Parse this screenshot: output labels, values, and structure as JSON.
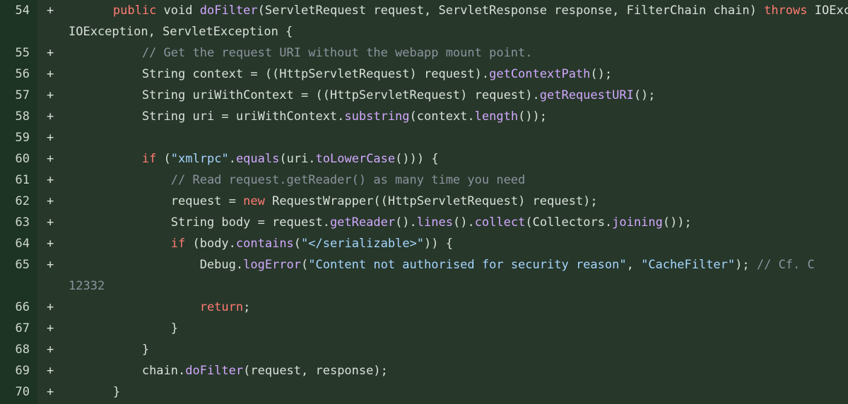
{
  "view": {
    "kind": "code-diff",
    "language": "Java",
    "change_type": "addition",
    "marker": "+"
  },
  "colors": {
    "gutter_background": "#1d3323",
    "code_background": "#27372a",
    "line_number": "#cfd8d0",
    "plain_text": "#d8e0da",
    "keyword": "#ff7b72",
    "function": "#d2a8ff",
    "string": "#a5d6ff",
    "comment": "#8b949e"
  },
  "lines": [
    {
      "number": "54",
      "marker": "+",
      "clipped": true,
      "tokens": [
        {
          "t": "        ",
          "c": "pln"
        },
        {
          "t": "public",
          "c": "kw"
        },
        {
          "t": " void ",
          "c": "pln"
        },
        {
          "t": "doFilter",
          "c": "fn"
        },
        {
          "t": "(ServletRequest request, ServletResponse response, FilterChain chain) ",
          "c": "pln"
        },
        {
          "t": "throws",
          "c": "kw"
        },
        {
          "t": " IOException, ServletException {",
          "c": "pln"
        }
      ],
      "continuation": [
        {
          "t": "IOException, ServletException {",
          "c": "pln"
        }
      ]
    },
    {
      "number": "55",
      "marker": "+",
      "clipped": false,
      "tokens": [
        {
          "t": "            ",
          "c": "pln"
        },
        {
          "t": "// Get the request URI without the webapp mount point.",
          "c": "cmt"
        }
      ]
    },
    {
      "number": "56",
      "marker": "+",
      "clipped": false,
      "tokens": [
        {
          "t": "            String context = ((HttpServletRequest) request).",
          "c": "pln"
        },
        {
          "t": "getContextPath",
          "c": "fn"
        },
        {
          "t": "();",
          "c": "pln"
        }
      ]
    },
    {
      "number": "57",
      "marker": "+",
      "clipped": false,
      "tokens": [
        {
          "t": "            String uriWithContext = ((HttpServletRequest) request).",
          "c": "pln"
        },
        {
          "t": "getRequestURI",
          "c": "fn"
        },
        {
          "t": "();",
          "c": "pln"
        }
      ]
    },
    {
      "number": "58",
      "marker": "+",
      "clipped": false,
      "tokens": [
        {
          "t": "            String uri = uriWithContext.",
          "c": "pln"
        },
        {
          "t": "substring",
          "c": "fn"
        },
        {
          "t": "(context.",
          "c": "pln"
        },
        {
          "t": "length",
          "c": "fn"
        },
        {
          "t": "());",
          "c": "pln"
        }
      ]
    },
    {
      "number": "59",
      "marker": "+",
      "clipped": false,
      "tokens": [
        {
          "t": "",
          "c": "pln"
        }
      ]
    },
    {
      "number": "60",
      "marker": "+",
      "clipped": false,
      "tokens": [
        {
          "t": "            ",
          "c": "pln"
        },
        {
          "t": "if",
          "c": "kw"
        },
        {
          "t": " (",
          "c": "pln"
        },
        {
          "t": "\"xmlrpc\"",
          "c": "str"
        },
        {
          "t": ".",
          "c": "pln"
        },
        {
          "t": "equals",
          "c": "fn"
        },
        {
          "t": "(uri.",
          "c": "pln"
        },
        {
          "t": "toLowerCase",
          "c": "fn"
        },
        {
          "t": "())) {",
          "c": "pln"
        }
      ]
    },
    {
      "number": "61",
      "marker": "+",
      "clipped": false,
      "tokens": [
        {
          "t": "                ",
          "c": "pln"
        },
        {
          "t": "// Read request.getReader() as many time you need",
          "c": "cmt"
        }
      ]
    },
    {
      "number": "62",
      "marker": "+",
      "clipped": false,
      "tokens": [
        {
          "t": "                request = ",
          "c": "pln"
        },
        {
          "t": "new",
          "c": "kw"
        },
        {
          "t": " RequestWrapper((HttpServletRequest) request);",
          "c": "pln"
        }
      ]
    },
    {
      "number": "63",
      "marker": "+",
      "clipped": false,
      "tokens": [
        {
          "t": "                String body = request.",
          "c": "pln"
        },
        {
          "t": "getReader",
          "c": "fn"
        },
        {
          "t": "().",
          "c": "pln"
        },
        {
          "t": "lines",
          "c": "fn"
        },
        {
          "t": "().",
          "c": "pln"
        },
        {
          "t": "collect",
          "c": "fn"
        },
        {
          "t": "(Collectors.",
          "c": "pln"
        },
        {
          "t": "joining",
          "c": "fn"
        },
        {
          "t": "());",
          "c": "pln"
        }
      ]
    },
    {
      "number": "64",
      "marker": "+",
      "clipped": false,
      "tokens": [
        {
          "t": "                ",
          "c": "pln"
        },
        {
          "t": "if",
          "c": "kw"
        },
        {
          "t": " (body.",
          "c": "pln"
        },
        {
          "t": "contains",
          "c": "fn"
        },
        {
          "t": "(",
          "c": "pln"
        },
        {
          "t": "\"</serializable>\"",
          "c": "str"
        },
        {
          "t": ")) {",
          "c": "pln"
        }
      ]
    },
    {
      "number": "65",
      "marker": "+",
      "clipped": true,
      "tokens": [
        {
          "t": "                    Debug.",
          "c": "pln"
        },
        {
          "t": "logError",
          "c": "fn"
        },
        {
          "t": "(",
          "c": "pln"
        },
        {
          "t": "\"Content not authorised for security reason\"",
          "c": "str"
        },
        {
          "t": ", ",
          "c": "pln"
        },
        {
          "t": "\"CacheFilter\"",
          "c": "str"
        },
        {
          "t": "); ",
          "c": "pln"
        },
        {
          "t": "// Cf. C",
          "c": "cmt"
        }
      ],
      "continuation": [
        {
          "t": "12332",
          "c": "cmt"
        }
      ]
    },
    {
      "number": "66",
      "marker": "+",
      "clipped": false,
      "tokens": [
        {
          "t": "                    ",
          "c": "pln"
        },
        {
          "t": "return",
          "c": "kw"
        },
        {
          "t": ";",
          "c": "pln"
        }
      ]
    },
    {
      "number": "67",
      "marker": "+",
      "clipped": false,
      "tokens": [
        {
          "t": "                }",
          "c": "pln"
        }
      ]
    },
    {
      "number": "68",
      "marker": "+",
      "clipped": false,
      "tokens": [
        {
          "t": "            }",
          "c": "pln"
        }
      ]
    },
    {
      "number": "69",
      "marker": "+",
      "clipped": false,
      "tokens": [
        {
          "t": "            chain.",
          "c": "pln"
        },
        {
          "t": "doFilter",
          "c": "fn"
        },
        {
          "t": "(request, response);",
          "c": "pln"
        }
      ]
    },
    {
      "number": "70",
      "marker": "+",
      "clipped": false,
      "tokens": [
        {
          "t": "        }",
          "c": "pln"
        }
      ]
    }
  ]
}
